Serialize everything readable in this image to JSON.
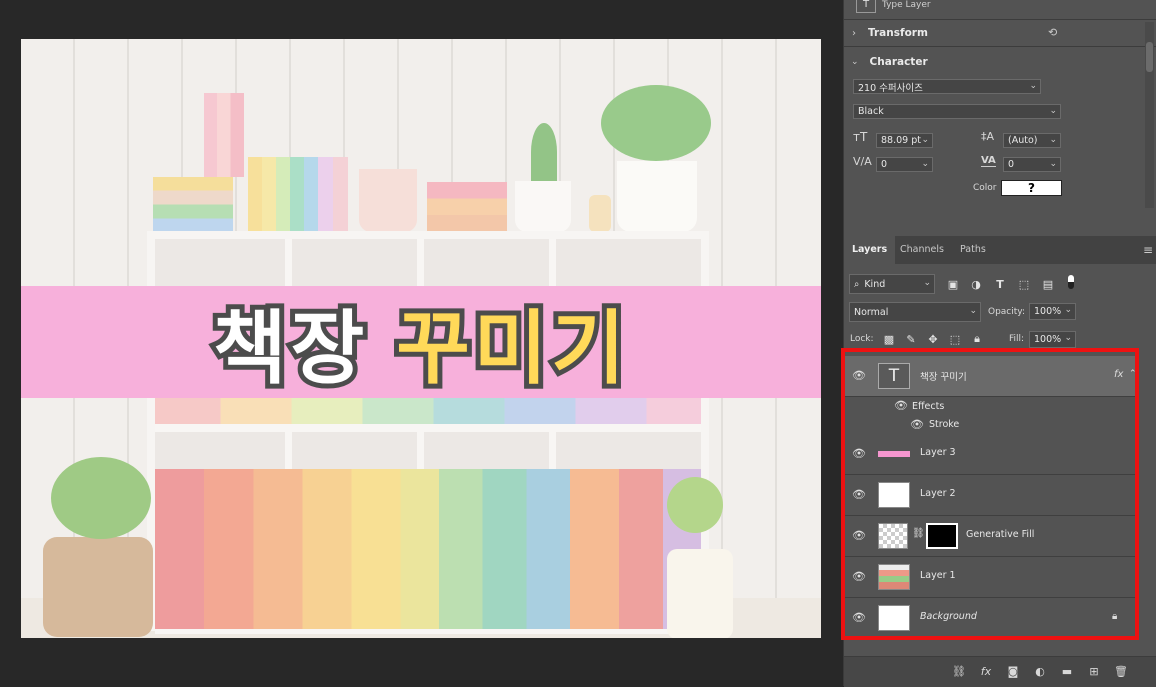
{
  "canvas": {
    "title_word1": "책장",
    "title_word2": "꾸미기",
    "banner_color": "#f596cf",
    "title_color_1": "#ffffff",
    "title_color_2": "#ffcc22"
  },
  "properties": {
    "header_label": "Type Layer",
    "transform_label": "Transform",
    "character_label": "Character",
    "font_family": "210 수퍼사이즈",
    "font_style": "Black",
    "font_size": "88.09 pt",
    "leading": "(Auto)",
    "kerning": "0",
    "tracking": "0",
    "color_label": "Color",
    "color_value": "?"
  },
  "layers_panel": {
    "tabs": [
      "Layers",
      "Channels",
      "Paths"
    ],
    "filter_kind": "Kind",
    "blend_mode": "Normal",
    "opacity_label": "Opacity:",
    "opacity_value": "100%",
    "lock_label": "Lock:",
    "fill_label": "Fill:",
    "fill_value": "100%",
    "layers": [
      {
        "name": "책장 꾸미기",
        "type": "text",
        "fx": "fx"
      },
      {
        "name": "Effects"
      },
      {
        "name": "Stroke"
      },
      {
        "name": "Layer 3"
      },
      {
        "name": "Layer 2"
      },
      {
        "name": "Generative Fill"
      },
      {
        "name": "Layer 1"
      },
      {
        "name": "Background"
      }
    ]
  },
  "icons": {
    "eye": "eye-icon",
    "lock": "lock-icon",
    "link": "link-icon",
    "panel_menu": "menu-icon"
  },
  "highlight_color": "#ee1111"
}
